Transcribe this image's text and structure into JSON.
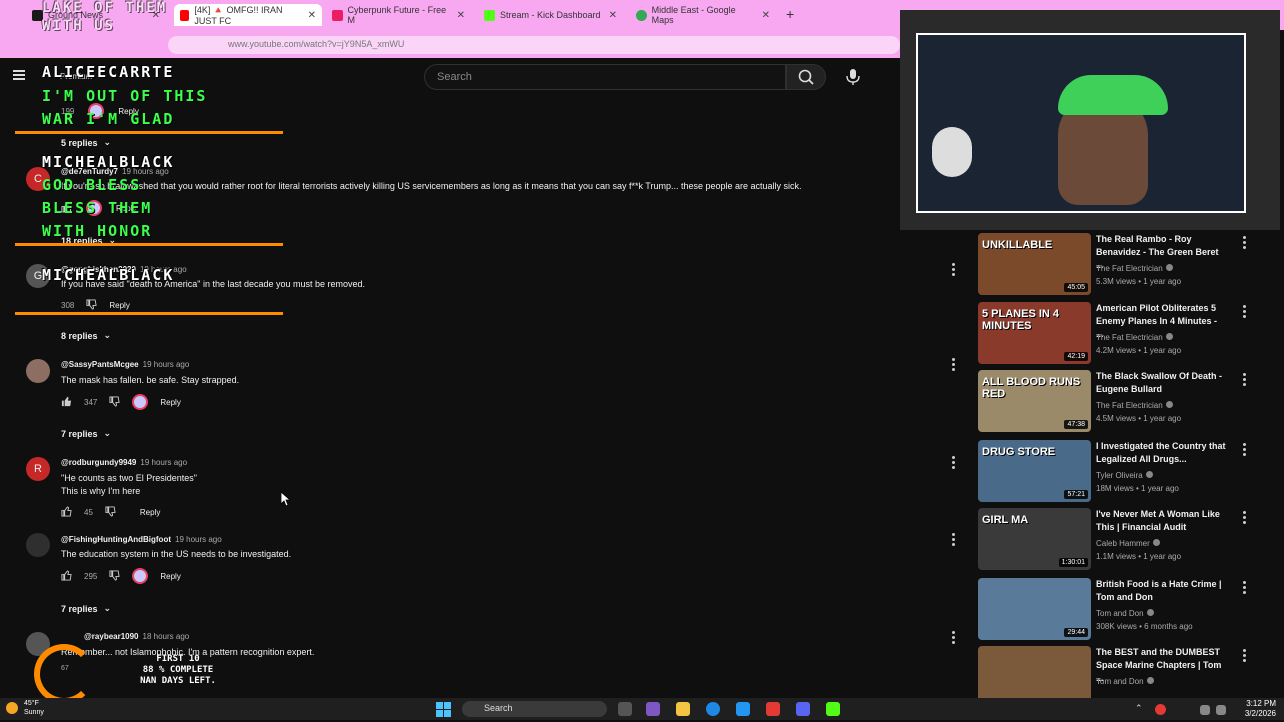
{
  "tabs": [
    {
      "label": "Ground News",
      "color": "#1a1a1a"
    },
    {
      "label": "[4K] 🔺 OMFG!! IRAN JUST FC",
      "color": "#ff0000"
    },
    {
      "label": "Cyberpunk Future - Free M",
      "color": "#e91e63"
    },
    {
      "label": "Stream - Kick Dashboard",
      "color": "#53fc18"
    },
    {
      "label": "Middle East - Google Maps",
      "color": "#34a853"
    }
  ],
  "new_tab": "+",
  "url": "www.youtube.com/watch?v=jY9N5A_xmWU",
  "youtube": {
    "premium": "Premium",
    "search_placeholder": "Search"
  },
  "overlay": {
    "top_partial": "LAKE OF THEM",
    "top_line2": "WITH US",
    "chat": [
      {
        "user": "ALICEECARRTE",
        "msg1": "I'M OUT OF THIS",
        "msg2": "WAR I'M GLAD"
      },
      {
        "user": "MICHEALBLACK",
        "msg1": "GOD BLESS",
        "msg2": "BLESS THEM",
        "msg3": "WITH HONOR"
      },
      {
        "user": "MICHEALBLACK"
      }
    ],
    "goal_line1": "FIRST 10",
    "goal_line2": "88 % COMPLETE",
    "goal_line3": "NAN DAYS LEFT.",
    "goal_count": "67"
  },
  "comments": [
    {
      "handle": "",
      "ago": "",
      "text": "",
      "likes": "199",
      "reply": "Reply",
      "replies": "5 replies"
    },
    {
      "handle": "@de7enTurdy7",
      "ago": "19 hours ago",
      "text": "If you're so brainwashed that you would rather root for literal terrorists actively killing US servicemembers as long as it means that you can say f**k Trump... these people are actually sick.",
      "likes": "",
      "reply": "Reply",
      "replies": "18 replies",
      "avatar_letter": "C",
      "avatar_color": "#c62828"
    },
    {
      "handle": "@genghiskhan2020",
      "ago": "19 hours ago",
      "text": "If you have said \"death to America\" in the last decade you must be removed.",
      "likes": "308",
      "reply": "Reply",
      "replies": "8 replies",
      "avatar_letter": "G",
      "avatar_color": "#555555"
    },
    {
      "handle": "@SassyPantsMcgee",
      "ago": "19 hours ago",
      "text": "The mask has fallen. be safe. Stay strapped.",
      "likes": "347",
      "reply": "Reply",
      "replies": "7 replies"
    },
    {
      "handle": "@rodburgundy9949",
      "ago": "19 hours ago",
      "text": "\"He counts as two El Presidentes\"",
      "text2": "This is why I'm here",
      "likes": "45",
      "reply": "Reply",
      "avatar_letter": "R",
      "avatar_color": "#c62828"
    },
    {
      "handle": "@FishingHuntingAndBigfoot",
      "ago": "19 hours ago",
      "text": "The education system in the US needs to be investigated.",
      "likes": "295",
      "reply": "Reply",
      "replies": "7 replies"
    },
    {
      "handle": "@raybear1090",
      "ago": "18 hours ago",
      "text": "Remember... not Islamophobic. I'm a pattern recognition expert."
    }
  ],
  "sidebar": [
    {
      "title": "The Real Rambo - Roy Benavidez - The Green Beret ...",
      "channel": "The Fat Electrician",
      "meta": "5.3M views • 1 year ago",
      "duration": "45:05",
      "thumb_text": "UNKILLABLE",
      "thumb_color": "#7a4a2a"
    },
    {
      "title": "American Pilot Obliterates 5 Enemy Planes In 4 Minutes - ...",
      "channel": "The Fat Electrician",
      "meta": "4.2M views • 1 year ago",
      "duration": "42:19",
      "thumb_text": "5 PLANES IN 4 MINUTES",
      "thumb_color": "#8a3a2a"
    },
    {
      "title": "The Black Swallow Of Death - Eugene Bullard",
      "channel": "The Fat Electrician",
      "meta": "4.5M views • 1 year ago",
      "duration": "47:38",
      "thumb_text": "ALL BLOOD RUNS RED",
      "thumb_color": "#9a8a6a"
    },
    {
      "title": "I Investigated the Country that Legalized All Drugs...",
      "channel": "Tyler Oliveira",
      "meta": "18M views • 1 year ago",
      "duration": "57:21",
      "thumb_text": "DRUG STORE",
      "thumb_color": "#4a6a8a"
    },
    {
      "title": "I've Never Met A Woman Like This | Financial Audit",
      "channel": "Caleb Hammer",
      "meta": "1.1M views • 1 year ago",
      "duration": "1:30:01",
      "thumb_text": "GIRL MA",
      "thumb_color": "#3a3a3a"
    },
    {
      "title": "British Food is a Hate Crime | Tom and Don",
      "channel": "Tom and Don",
      "meta": "308K views • 6 months ago",
      "duration": "29:44",
      "thumb_text": "",
      "thumb_color": "#5a7a9a"
    },
    {
      "title": "The BEST and the DUMBEST Space Marine Chapters | Tom ...",
      "channel": "Tom and Don",
      "meta": "",
      "duration": "",
      "thumb_text": "",
      "thumb_color": "#7a5a3a"
    }
  ],
  "taskbar": {
    "weather_temp": "45°F",
    "weather_desc": "Sunny",
    "search": "Search",
    "time": "3:12 PM",
    "date": "3/2/2026"
  }
}
